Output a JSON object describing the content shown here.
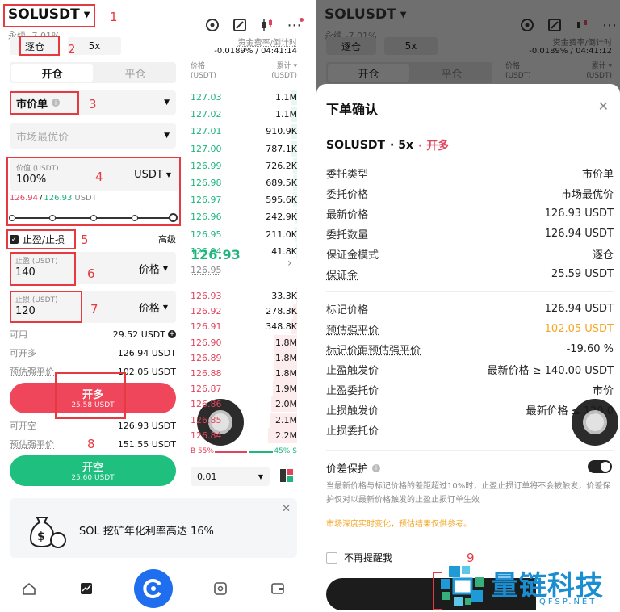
{
  "left": {
    "header": {
      "symbol": "SOLUSDT",
      "subtitle": "永续 -7.01%",
      "funding_label": "资金费率/倒计时",
      "funding_value": "-0.0189% / 04:41:14"
    },
    "margin_mode": "逐仓",
    "leverage": "5x",
    "tabs": {
      "open": "开仓",
      "close": "平仓"
    },
    "order_type": "市价单",
    "price_placeholder": "市场最优价",
    "value_label": "价值 (USDT)",
    "value": "100%",
    "value_unit": "USDT",
    "mark_last": "126.94",
    "mark_last2": "126.93",
    "mark_unit": "USDT",
    "tpsl_label": "止盈/止损",
    "tpsl_checked": true,
    "advanced": "高级",
    "tp_label": "止盈 (USDT)",
    "tp_value": "140",
    "tp_type": "价格",
    "sl_label": "止损 (USDT)",
    "sl_value": "120",
    "sl_type": "价格",
    "available_label": "可用",
    "available_value": "29.52 USDT",
    "can_long_label": "可开多",
    "can_long_value": "126.94 USDT",
    "liq_label": "预估强平价",
    "liq_value": "102.05 USDT",
    "long_button": "开多",
    "long_sub": "25.58 USDT",
    "can_short_label": "可开空",
    "can_short_value": "126.93 USDT",
    "liq2_label": "预估强平价",
    "liq2_value": "151.55 USDT",
    "short_button": "开空",
    "short_sub": "25.60 USDT",
    "promo_text": "SOL 挖矿年化利率高达 16%",
    "orderbook": {
      "price_header": "价格\n(USDT)",
      "price_header_1": "价格",
      "price_header_2": "(USDT)",
      "total_header_1": "累计",
      "total_header_2": "(USDT)",
      "asks": [
        {
          "price": "127.03",
          "total": "1.1M",
          "depth": 0.06
        },
        {
          "price": "127.02",
          "total": "1.1M",
          "depth": 0.06
        },
        {
          "price": "127.01",
          "total": "910.9K",
          "depth": 0.05
        },
        {
          "price": "127.00",
          "total": "787.1K",
          "depth": 0.05
        },
        {
          "price": "126.99",
          "total": "726.2K",
          "depth": 0.04
        },
        {
          "price": "126.98",
          "total": "689.5K",
          "depth": 0.04
        },
        {
          "price": "126.97",
          "total": "595.6K",
          "depth": 0.04
        },
        {
          "price": "126.96",
          "total": "242.9K",
          "depth": 0.02
        },
        {
          "price": "126.95",
          "total": "211.0K",
          "depth": 0.02
        },
        {
          "price": "126.94",
          "total": "41.8K",
          "depth": 0.01
        }
      ],
      "last_price": "126.93",
      "mark_price": "126.95",
      "bids": [
        {
          "price": "126.93",
          "total": "33.3K",
          "depth": 0.01
        },
        {
          "price": "126.92",
          "total": "278.3K",
          "depth": 0.04
        },
        {
          "price": "126.91",
          "total": "348.8K",
          "depth": 0.05
        },
        {
          "price": "126.90",
          "total": "1.8M",
          "depth": 0.22
        },
        {
          "price": "126.89",
          "total": "1.8M",
          "depth": 0.22
        },
        {
          "price": "126.88",
          "total": "1.8M",
          "depth": 0.22
        },
        {
          "price": "126.87",
          "total": "1.9M",
          "depth": 0.23
        },
        {
          "price": "126.86",
          "total": "2.0M",
          "depth": 0.24
        },
        {
          "price": "126.85",
          "total": "2.1M",
          "depth": 0.25
        },
        {
          "price": "126.84",
          "total": "2.2M",
          "depth": 0.27
        }
      ],
      "buy_ratio": "B 55%",
      "sell_ratio": "45% S",
      "buy_fraction": 0.55,
      "precision": "0.01"
    },
    "annotations": [
      "1",
      "2",
      "3",
      "4",
      "5",
      "6",
      "7",
      "8"
    ]
  },
  "right": {
    "header": {
      "symbol": "SOLUSDT",
      "subtitle": "永续 -7.01%",
      "funding_label": "资金费率/倒计时",
      "funding_value": "-0.0189% / 04:41:12"
    },
    "margin_mode": "逐仓",
    "leverage": "5x",
    "tabs": {
      "open": "开仓",
      "close": "平仓"
    },
    "ob_header_price_1": "价格",
    "ob_header_price_2": "(USDT)",
    "ob_header_total_1": "累计",
    "ob_header_total_2": "(USDT)",
    "modal": {
      "title": "下单确认",
      "symbol": "SOLUSDT",
      "leverage": "· 5x",
      "side": "· 开多",
      "rows": [
        {
          "k": "委托类型",
          "v": "市价单"
        },
        {
          "k": "委托价格",
          "v": "市场最优价"
        },
        {
          "k": "最新价格",
          "v": "126.93 USDT"
        },
        {
          "k": "委托数量",
          "v": "126.94 USDT"
        },
        {
          "k": "保证金模式",
          "v": "逐仓"
        },
        {
          "k": "保证金",
          "v": "25.59 USDT"
        }
      ],
      "rows2": [
        {
          "k": "标记价格",
          "v": "126.94 USDT"
        },
        {
          "k": "预估强平价",
          "v": "102.05 USDT"
        },
        {
          "k": "标记价距预估强平价",
          "v": "-19.60 %"
        },
        {
          "k": "止盈触发价",
          "v": "最新价格 ≥ 140.00 USDT"
        },
        {
          "k": "止盈委托价",
          "v": "市价"
        },
        {
          "k": "止损触发价",
          "v": "最新价格 ≤ 120.0"
        },
        {
          "k": "止损委托价",
          "v": ""
        }
      ],
      "protect_label": "价差保护",
      "protect_on": true,
      "protect_desc": "当最新价格与标记价格的差距超过10%时，止盈止损订单将不会被触发，价差保护仅对以最新价格触发的止盈止损订单生效",
      "depth_note": "市场深度实时变化，预估结果仅供参考。",
      "no_remind": "不再提醒我",
      "annotation": "9"
    },
    "watermark": {
      "cn": "量链科技",
      "en": "QFSP.NET"
    }
  },
  "colors": {
    "green": "#1fb57d",
    "red": "#e0455c",
    "orange": "#f5a623",
    "annotation": "#e53a40"
  }
}
